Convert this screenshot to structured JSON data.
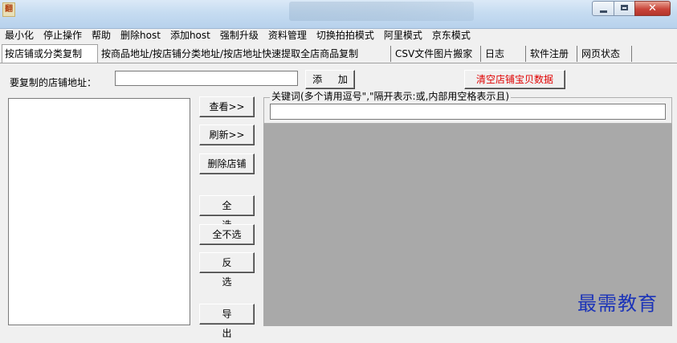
{
  "window": {
    "app_icon_text": "翻",
    "controls": {
      "close_glyph": "✕"
    }
  },
  "menu": [
    "最小化",
    "停止操作",
    "帮助",
    "删除host",
    "添加host",
    "强制升级",
    "资料管理",
    "切换拍拍模式",
    "阿里模式",
    "京东模式"
  ],
  "tabs": [
    "按店铺或分类复制",
    "按商品地址/按店铺分类地址/按店地址快速提取全店商品复制",
    "CSV文件图片搬家",
    "日志",
    "软件注册",
    "网页状态"
  ],
  "active_tab_index": 0,
  "address": {
    "label": "要复制的店铺地址：",
    "value": "",
    "add_button": "添 加",
    "clear_button": "清空店铺宝贝数据"
  },
  "side_buttons": {
    "view": "查看>>",
    "refresh": "刷新>>",
    "delete_shop": "删除店铺",
    "select_all": "全 选",
    "select_none": "全不选",
    "invert": "反 选",
    "export": "导 出"
  },
  "keywords": {
    "legend": "关键词(多个请用逗号\",\"隔开表示:或,内部用空格表示且)",
    "value": ""
  },
  "watermark": "最需教育",
  "colors": {
    "clear_button_text": "#e00000",
    "watermark": "#1c34b8",
    "results_area": "#a9a9a9"
  }
}
